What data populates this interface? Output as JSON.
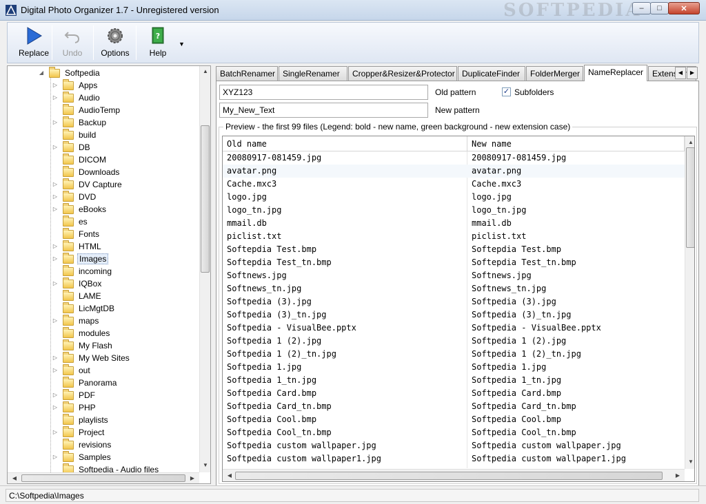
{
  "window": {
    "title": "Digital Photo Organizer 1.7 - Unregistered version",
    "watermark": "SOFTPEDIA",
    "minimize": "–",
    "maximize": "□",
    "close": "✕"
  },
  "toolbar": {
    "replace": "Replace",
    "undo": "Undo",
    "options": "Options",
    "help": "Help",
    "help_dropdown": "▼"
  },
  "tree": {
    "root": "Softpedia",
    "items": [
      {
        "label": "Apps",
        "expandable": true
      },
      {
        "label": "Audio",
        "expandable": true
      },
      {
        "label": "AudioTemp",
        "expandable": false
      },
      {
        "label": "Backup",
        "expandable": true
      },
      {
        "label": "build",
        "expandable": false
      },
      {
        "label": "DB",
        "expandable": true
      },
      {
        "label": "DICOM",
        "expandable": false
      },
      {
        "label": "Downloads",
        "expandable": false
      },
      {
        "label": "DV Capture",
        "expandable": true
      },
      {
        "label": "DVD",
        "expandable": true
      },
      {
        "label": "eBooks",
        "expandable": true
      },
      {
        "label": "es",
        "expandable": false
      },
      {
        "label": "Fonts",
        "expandable": false
      },
      {
        "label": "HTML",
        "expandable": true
      },
      {
        "label": "Images",
        "expandable": true,
        "selected": true
      },
      {
        "label": "incoming",
        "expandable": false
      },
      {
        "label": "IQBox",
        "expandable": true
      },
      {
        "label": "LAME",
        "expandable": false
      },
      {
        "label": "LicMgtDB",
        "expandable": false
      },
      {
        "label": "maps",
        "expandable": true
      },
      {
        "label": "modules",
        "expandable": false
      },
      {
        "label": "My Flash",
        "expandable": false
      },
      {
        "label": "My Web Sites",
        "expandable": true
      },
      {
        "label": "out",
        "expandable": true
      },
      {
        "label": "Panorama",
        "expandable": false
      },
      {
        "label": "PDF",
        "expandable": true
      },
      {
        "label": "PHP",
        "expandable": true
      },
      {
        "label": "playlists",
        "expandable": false
      },
      {
        "label": "Project",
        "expandable": true
      },
      {
        "label": "revisions",
        "expandable": false
      },
      {
        "label": "Samples",
        "expandable": true
      },
      {
        "label": "Softpedia - Audio files",
        "expandable": false
      }
    ]
  },
  "tabs": [
    {
      "label": "BatchRenamer",
      "active": false
    },
    {
      "label": "SingleRenamer",
      "active": false
    },
    {
      "label": "Cropper&Resizer&Protector",
      "active": false
    },
    {
      "label": "DuplicateFinder",
      "active": false
    },
    {
      "label": "FolderMerger",
      "active": false
    },
    {
      "label": "NameReplacer",
      "active": true
    },
    {
      "label": "Extensions",
      "active": false
    }
  ],
  "form": {
    "old_pattern_value": "XYZ123",
    "old_pattern_label": "Old pattern",
    "new_pattern_value": "My_New_Text",
    "new_pattern_label": "New pattern",
    "subfolders_label": "Subfolders",
    "subfolders_checked": true,
    "subfolders_mark": "✓"
  },
  "preview": {
    "label": "Preview - the first 99 files (Legend: bold - new name, green background - new extension case)",
    "columns": [
      "Old name",
      "New name"
    ],
    "rows": [
      [
        "20080917-081459.jpg",
        "20080917-081459.jpg"
      ],
      [
        "avatar.png",
        "avatar.png"
      ],
      [
        "Cache.mxc3",
        "Cache.mxc3"
      ],
      [
        "logo.jpg",
        "logo.jpg"
      ],
      [
        "logo_tn.jpg",
        "logo_tn.jpg"
      ],
      [
        "mmail.db",
        "mmail.db"
      ],
      [
        "piclist.txt",
        "piclist.txt"
      ],
      [
        "Softepdia Test.bmp",
        "Softepdia Test.bmp"
      ],
      [
        "Softepdia Test_tn.bmp",
        "Softepdia Test_tn.bmp"
      ],
      [
        "Softnews.jpg",
        "Softnews.jpg"
      ],
      [
        "Softnews_tn.jpg",
        "Softnews_tn.jpg"
      ],
      [
        "Softpedia (3).jpg",
        "Softpedia (3).jpg"
      ],
      [
        "Softpedia (3)_tn.jpg",
        "Softpedia (3)_tn.jpg"
      ],
      [
        "Softpedia - VisualBee.pptx",
        "Softpedia - VisualBee.pptx"
      ],
      [
        "Softpedia 1 (2).jpg",
        "Softpedia 1 (2).jpg"
      ],
      [
        "Softpedia 1 (2)_tn.jpg",
        "Softpedia 1 (2)_tn.jpg"
      ],
      [
        "Softpedia 1.jpg",
        "Softpedia 1.jpg"
      ],
      [
        "Softpedia 1_tn.jpg",
        "Softpedia 1_tn.jpg"
      ],
      [
        "Softpedia Card.bmp",
        "Softpedia Card.bmp"
      ],
      [
        "Softpedia Card_tn.bmp",
        "Softpedia Card_tn.bmp"
      ],
      [
        "Softpedia Cool.bmp",
        "Softpedia Cool.bmp"
      ],
      [
        "Softpedia Cool_tn.bmp",
        "Softpedia Cool_tn.bmp"
      ],
      [
        "Softpedia custom wallpaper.jpg",
        "Softpedia custom wallpaper.jpg"
      ],
      [
        "Softpedia custom wallpaper1.jpg",
        "Softpedia custom wallpaper1.jpg"
      ]
    ]
  },
  "status": {
    "path": "C:\\Softpedia\\Images"
  },
  "colors": {
    "accent": "#2a6bd6",
    "selection": "#e5eefa"
  }
}
